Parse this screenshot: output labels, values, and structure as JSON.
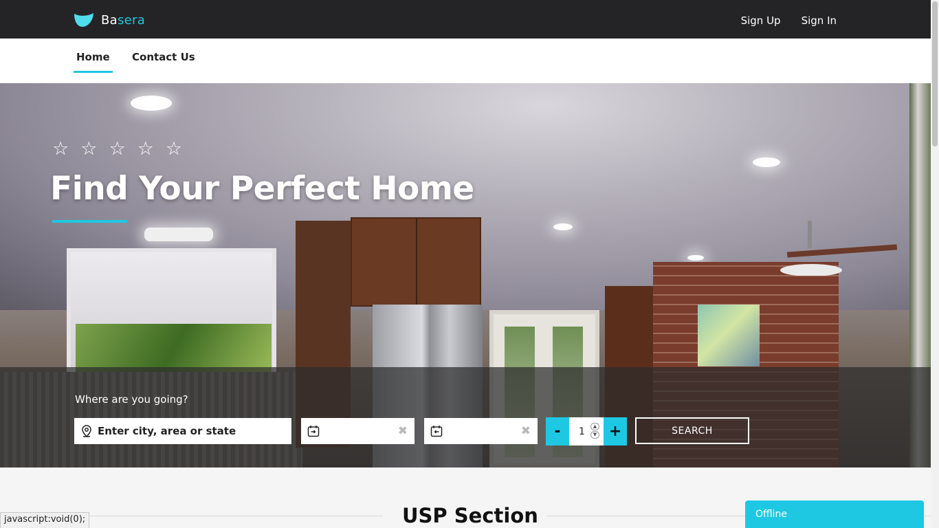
{
  "brand": {
    "name_part1": "Ba",
    "name_part2": "sera",
    "accent_color": "#1ec8e3"
  },
  "top_nav": {
    "sign_up": "Sign Up",
    "sign_in": "Sign In"
  },
  "sub_nav": {
    "home": "Home",
    "contact": "Contact Us"
  },
  "hero": {
    "rating_stars": 5,
    "title": "Find Your Perfect Home"
  },
  "search": {
    "label": "Where are you going?",
    "location_placeholder": "Enter city, area or state",
    "clear_symbol": "✖",
    "guests_value": "1",
    "minus": "-",
    "plus": "+",
    "button": "SEARCH"
  },
  "usp": {
    "title": "USP Section"
  },
  "status_bar": {
    "text": "javascript:void(0);"
  },
  "chat": {
    "status": "Offline"
  }
}
